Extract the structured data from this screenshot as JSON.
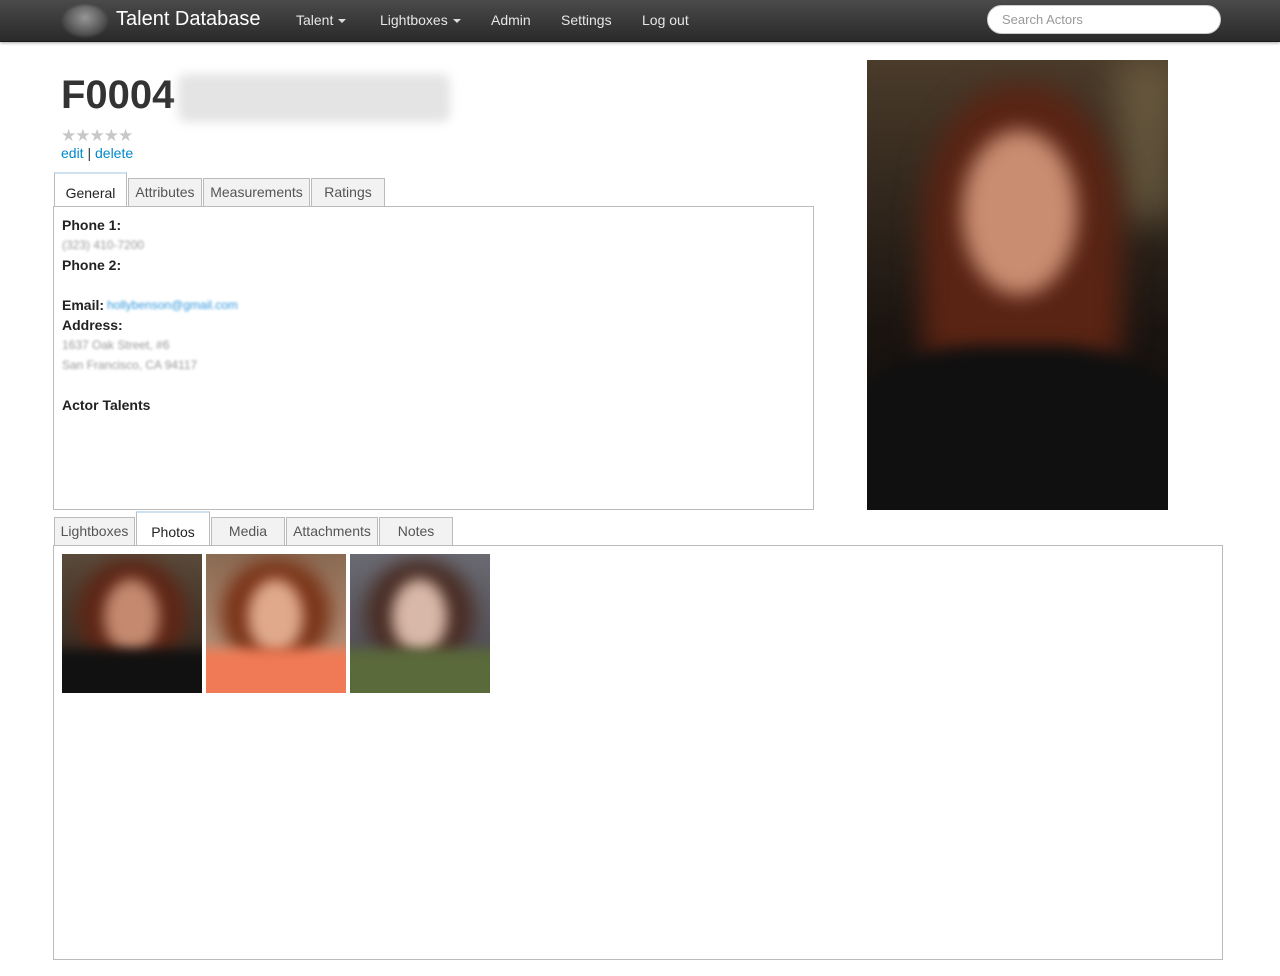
{
  "nav": {
    "brand": "Talent Database",
    "items": [
      {
        "label": "Talent",
        "dropdown": true
      },
      {
        "label": "Lightboxes",
        "dropdown": true
      },
      {
        "label": "Admin",
        "dropdown": false
      },
      {
        "label": "Settings",
        "dropdown": false
      },
      {
        "label": "Log out",
        "dropdown": false
      }
    ],
    "search_placeholder": "Search Actors"
  },
  "actor": {
    "id": "F0004",
    "rating_stars": "★★★★★",
    "rating_value": 0,
    "edit_label": "edit",
    "separator": "|",
    "delete_label": "delete"
  },
  "info_tabs": [
    "General",
    "Attributes",
    "Measurements",
    "Ratings"
  ],
  "general": {
    "phone1_label": "Phone 1:",
    "phone1_value": "(323) 410-7200",
    "phone2_label": "Phone 2:",
    "email_label": "Email:",
    "email_value": "hollybenson@gmail.com",
    "address_label": "Address:",
    "address_line1": "1637 Oak Street, #6",
    "address_line2": "San Francisco, CA 94117",
    "talents_label": "Actor Talents"
  },
  "media_tabs": [
    "Lightboxes",
    "Photos",
    "Media",
    "Attachments",
    "Notes"
  ],
  "colors": {
    "navbar": "#333333",
    "link": "#0088cc",
    "border": "#bbbbbb"
  }
}
